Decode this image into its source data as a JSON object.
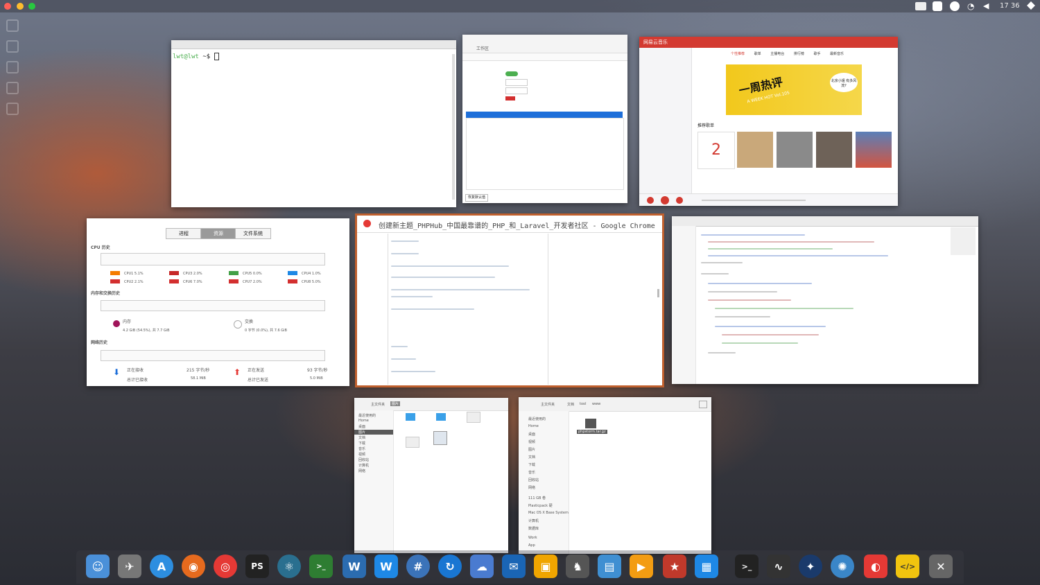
{
  "topbar": {
    "clock": "17 36"
  },
  "terminal": {
    "prompt": "lwt@lwt",
    "path": "~$"
  },
  "settings": {
    "title": "工作区",
    "footer_btn": "恢复默认值"
  },
  "music": {
    "app_name": "网易云音乐",
    "tabs": [
      "个性推荐",
      "歌单",
      "主播电台",
      "排行榜",
      "歌手",
      "最新音乐"
    ],
    "banner_title": "一周热评",
    "banner_sub": "A WEEK HOT Vol.105",
    "banner_tag": "北京小姐 有多风流?",
    "section": "推荐歌单",
    "daily_number": "2"
  },
  "monitor": {
    "tabs": [
      "进程",
      "资源",
      "文件系统"
    ],
    "cpu_title": "CPU 历史",
    "cpus": [
      "CPU1 5.1%",
      "CPU3 2.0%",
      "CPU5 0.0%",
      "CPU4 1.0%",
      "CPU2 2.1%",
      "CPU6 7.0%",
      "CPU7 2.0%",
      "CPU8 5.0%"
    ],
    "mem_title": "内存和交换历史",
    "mem_label": "内存",
    "mem_value": "4.2 GiB (54.5%), 共 7.7 GiB",
    "swap_label": "交换",
    "swap_value": "0 字节 (0.0%), 共 7.6 GiB",
    "net_title": "网络历史",
    "recv_label": "正在接收",
    "recv_total_label": "总计已接收",
    "recv_rate": "215 字节/秒",
    "recv_total": "58.1 MiB",
    "send_label": "正在发送",
    "send_total_label": "总计已发送",
    "send_rate": "93 字节/秒",
    "send_total": "5.0 MiB"
  },
  "chrome": {
    "title": "创建新主题_PHPHub_中国最靠谱的_PHP_和_Laravel_开发者社区 - Google Chrome"
  },
  "files1": {
    "crumbs": [
      "主文件夹",
      "图片"
    ],
    "sidebar": [
      "最近使用的",
      "Home",
      "桌面",
      "图片",
      "文档",
      "下载",
      "音乐",
      "视频",
      "回收站",
      "计算机",
      "网络"
    ]
  },
  "files2": {
    "crumbs": [
      "主文件夹",
      "文档",
      "tool",
      "www"
    ],
    "sidebar": [
      "最近使用的",
      "Home",
      "桌面",
      "视频",
      "图片",
      "文档",
      "下载",
      "音乐",
      "回收站",
      "网络",
      "111 GB 卷",
      "Plasticpack 硬",
      "Mac OS X Base System",
      "计算机",
      "数据库",
      "Work",
      "App"
    ],
    "file": "phpstorm.tar.gz"
  },
  "dock": {
    "apps": [
      "finder-icon",
      "launchpad-icon",
      "appstore-icon",
      "firefox-icon",
      "chrome-icon",
      "phpstorm-icon",
      "atom-icon",
      "terminal-green-icon",
      "wps-writer-icon",
      "word-icon",
      "sharp-icon",
      "sync-icon",
      "weather-icon",
      "mail-icon",
      "sublime-icon",
      "gimp-icon",
      "image-viewer-icon",
      "video-icon",
      "bookmarks-icon",
      "lightpad-icon",
      "terminal-icon",
      "monitor-icon",
      "safari-icon",
      "pinwheel-icon",
      "netease-icon",
      "editor-icon",
      "close-app-icon"
    ]
  }
}
